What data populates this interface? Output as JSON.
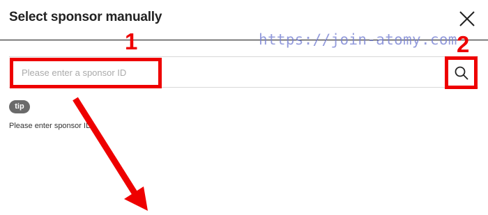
{
  "dialog": {
    "title": "Select sponsor manually"
  },
  "watermark": "https://join-atomy.com",
  "search": {
    "placeholder": "Please enter a sponsor ID",
    "value": ""
  },
  "tip": {
    "badge": "tip",
    "text": "Please enter sponsor ID"
  },
  "annotations": {
    "step_1": "1",
    "step_2": "2"
  },
  "icons": {
    "close": "close-icon",
    "search": "search-icon"
  },
  "colors": {
    "annotation_red": "#ee0000",
    "watermark": "#7680d2",
    "tip_badge": "#6a6a6a"
  }
}
